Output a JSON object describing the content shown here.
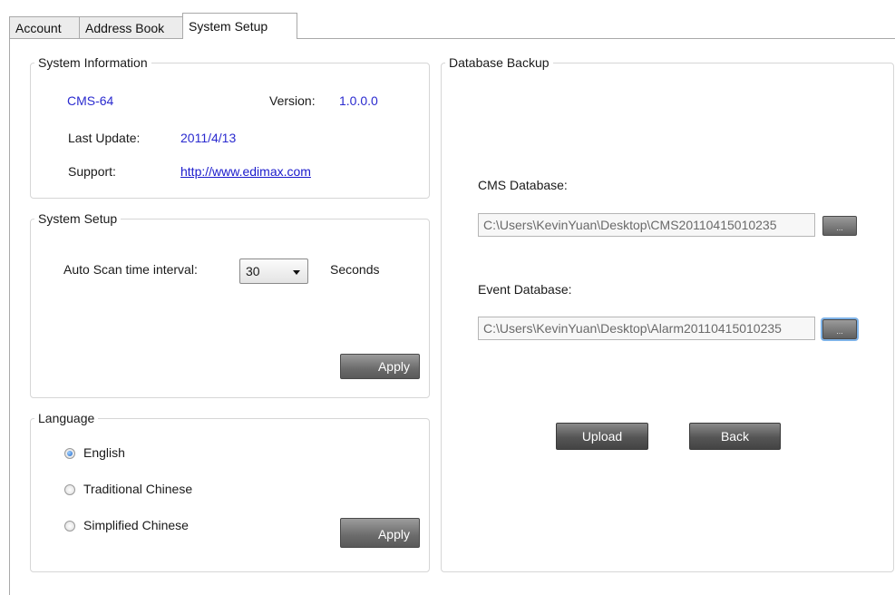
{
  "tabs": [
    "Account",
    "Address Book",
    "System Setup"
  ],
  "system_information": {
    "legend": "System Information",
    "model": "CMS-64",
    "version_label": "Version:",
    "version": "1.0.0.0",
    "last_update_label": "Last Update:",
    "last_update": "2011/4/13",
    "support_label": "Support:",
    "support_link": "http://www.edimax.com"
  },
  "system_setup": {
    "legend": "System Setup",
    "scan_label": "Auto Scan time interval:",
    "scan_value": "30",
    "unit": "Seconds",
    "apply": "Apply"
  },
  "language": {
    "legend": "Language",
    "options": [
      "English",
      "Traditional Chinese",
      "Simplified Chinese"
    ],
    "selected": "English",
    "apply": "Apply"
  },
  "database_backup": {
    "legend": "Database Backup",
    "cms_label": "CMS Database:",
    "cms_path": "C:\\Users\\KevinYuan\\Desktop\\CMS20110415010235",
    "event_label": "Event Database:",
    "event_path": "C:\\Users\\KevinYuan\\Desktop\\Alarm20110415010235",
    "browse": "...",
    "upload": "Upload",
    "back": "Back"
  },
  "colors": {
    "value_text": "#2a2acf",
    "link": "#1a1acc",
    "button_gray": "#6b6b6b",
    "radio_checked": "#1e66c8"
  }
}
